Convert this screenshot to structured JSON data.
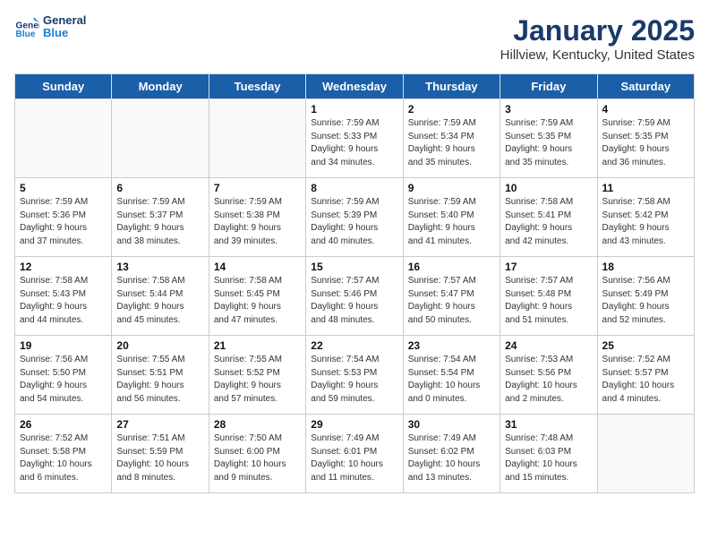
{
  "logo": {
    "line1": "General",
    "line2": "Blue"
  },
  "title": "January 2025",
  "subtitle": "Hillview, Kentucky, United States",
  "weekdays": [
    "Sunday",
    "Monday",
    "Tuesday",
    "Wednesday",
    "Thursday",
    "Friday",
    "Saturday"
  ],
  "weeks": [
    [
      {
        "day": "",
        "info": ""
      },
      {
        "day": "",
        "info": ""
      },
      {
        "day": "",
        "info": ""
      },
      {
        "day": "1",
        "info": "Sunrise: 7:59 AM\nSunset: 5:33 PM\nDaylight: 9 hours\nand 34 minutes."
      },
      {
        "day": "2",
        "info": "Sunrise: 7:59 AM\nSunset: 5:34 PM\nDaylight: 9 hours\nand 35 minutes."
      },
      {
        "day": "3",
        "info": "Sunrise: 7:59 AM\nSunset: 5:35 PM\nDaylight: 9 hours\nand 35 minutes."
      },
      {
        "day": "4",
        "info": "Sunrise: 7:59 AM\nSunset: 5:35 PM\nDaylight: 9 hours\nand 36 minutes."
      }
    ],
    [
      {
        "day": "5",
        "info": "Sunrise: 7:59 AM\nSunset: 5:36 PM\nDaylight: 9 hours\nand 37 minutes."
      },
      {
        "day": "6",
        "info": "Sunrise: 7:59 AM\nSunset: 5:37 PM\nDaylight: 9 hours\nand 38 minutes."
      },
      {
        "day": "7",
        "info": "Sunrise: 7:59 AM\nSunset: 5:38 PM\nDaylight: 9 hours\nand 39 minutes."
      },
      {
        "day": "8",
        "info": "Sunrise: 7:59 AM\nSunset: 5:39 PM\nDaylight: 9 hours\nand 40 minutes."
      },
      {
        "day": "9",
        "info": "Sunrise: 7:59 AM\nSunset: 5:40 PM\nDaylight: 9 hours\nand 41 minutes."
      },
      {
        "day": "10",
        "info": "Sunrise: 7:58 AM\nSunset: 5:41 PM\nDaylight: 9 hours\nand 42 minutes."
      },
      {
        "day": "11",
        "info": "Sunrise: 7:58 AM\nSunset: 5:42 PM\nDaylight: 9 hours\nand 43 minutes."
      }
    ],
    [
      {
        "day": "12",
        "info": "Sunrise: 7:58 AM\nSunset: 5:43 PM\nDaylight: 9 hours\nand 44 minutes."
      },
      {
        "day": "13",
        "info": "Sunrise: 7:58 AM\nSunset: 5:44 PM\nDaylight: 9 hours\nand 45 minutes."
      },
      {
        "day": "14",
        "info": "Sunrise: 7:58 AM\nSunset: 5:45 PM\nDaylight: 9 hours\nand 47 minutes."
      },
      {
        "day": "15",
        "info": "Sunrise: 7:57 AM\nSunset: 5:46 PM\nDaylight: 9 hours\nand 48 minutes."
      },
      {
        "day": "16",
        "info": "Sunrise: 7:57 AM\nSunset: 5:47 PM\nDaylight: 9 hours\nand 50 minutes."
      },
      {
        "day": "17",
        "info": "Sunrise: 7:57 AM\nSunset: 5:48 PM\nDaylight: 9 hours\nand 51 minutes."
      },
      {
        "day": "18",
        "info": "Sunrise: 7:56 AM\nSunset: 5:49 PM\nDaylight: 9 hours\nand 52 minutes."
      }
    ],
    [
      {
        "day": "19",
        "info": "Sunrise: 7:56 AM\nSunset: 5:50 PM\nDaylight: 9 hours\nand 54 minutes."
      },
      {
        "day": "20",
        "info": "Sunrise: 7:55 AM\nSunset: 5:51 PM\nDaylight: 9 hours\nand 56 minutes."
      },
      {
        "day": "21",
        "info": "Sunrise: 7:55 AM\nSunset: 5:52 PM\nDaylight: 9 hours\nand 57 minutes."
      },
      {
        "day": "22",
        "info": "Sunrise: 7:54 AM\nSunset: 5:53 PM\nDaylight: 9 hours\nand 59 minutes."
      },
      {
        "day": "23",
        "info": "Sunrise: 7:54 AM\nSunset: 5:54 PM\nDaylight: 10 hours\nand 0 minutes."
      },
      {
        "day": "24",
        "info": "Sunrise: 7:53 AM\nSunset: 5:56 PM\nDaylight: 10 hours\nand 2 minutes."
      },
      {
        "day": "25",
        "info": "Sunrise: 7:52 AM\nSunset: 5:57 PM\nDaylight: 10 hours\nand 4 minutes."
      }
    ],
    [
      {
        "day": "26",
        "info": "Sunrise: 7:52 AM\nSunset: 5:58 PM\nDaylight: 10 hours\nand 6 minutes."
      },
      {
        "day": "27",
        "info": "Sunrise: 7:51 AM\nSunset: 5:59 PM\nDaylight: 10 hours\nand 8 minutes."
      },
      {
        "day": "28",
        "info": "Sunrise: 7:50 AM\nSunset: 6:00 PM\nDaylight: 10 hours\nand 9 minutes."
      },
      {
        "day": "29",
        "info": "Sunrise: 7:49 AM\nSunset: 6:01 PM\nDaylight: 10 hours\nand 11 minutes."
      },
      {
        "day": "30",
        "info": "Sunrise: 7:49 AM\nSunset: 6:02 PM\nDaylight: 10 hours\nand 13 minutes."
      },
      {
        "day": "31",
        "info": "Sunrise: 7:48 AM\nSunset: 6:03 PM\nDaylight: 10 hours\nand 15 minutes."
      },
      {
        "day": "",
        "info": ""
      }
    ]
  ]
}
